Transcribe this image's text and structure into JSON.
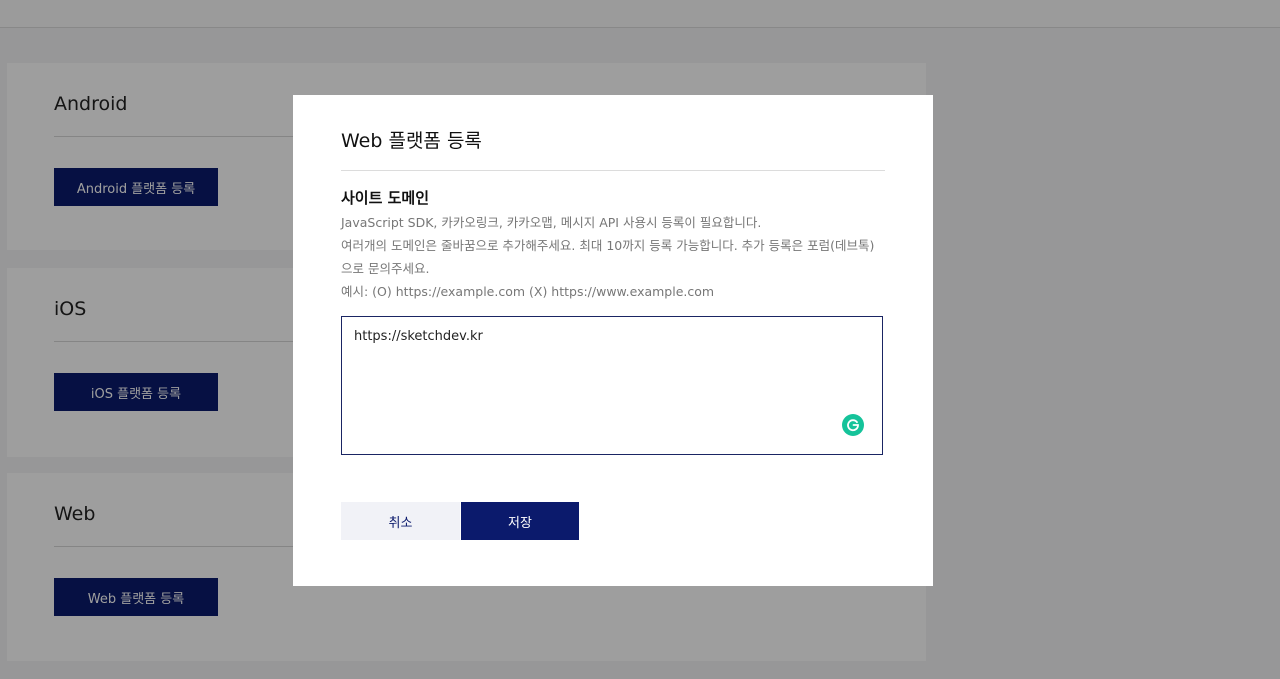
{
  "platforms": {
    "android": {
      "title": "Android",
      "button_label": "Android 플랫폼 등록"
    },
    "ios": {
      "title": "iOS",
      "button_label": "iOS 플랫폼 등록"
    },
    "web": {
      "title": "Web",
      "button_label": "Web 플랫폼 등록"
    }
  },
  "modal": {
    "title": "Web 플랫폼 등록",
    "section_title": "사이트 도메인",
    "help_lines": [
      "JavaScript SDK, 카카오링크, 카카오맵, 메시지 API 사용시 등록이 필요합니다.",
      "여러개의 도메인은 줄바꿈으로 추가해주세요. 최대 10까지 등록 가능합니다. 추가 등록은 포럼(데브톡)",
      "으로 문의주세요.",
      "예시: (O) https://example.com (X) https://www.example.com"
    ],
    "domain_value": "https://sketchdev.kr",
    "cancel_label": "취소",
    "save_label": "저장"
  },
  "colors": {
    "primary": "#0b1a6c",
    "grammarly": "#15c39a"
  }
}
